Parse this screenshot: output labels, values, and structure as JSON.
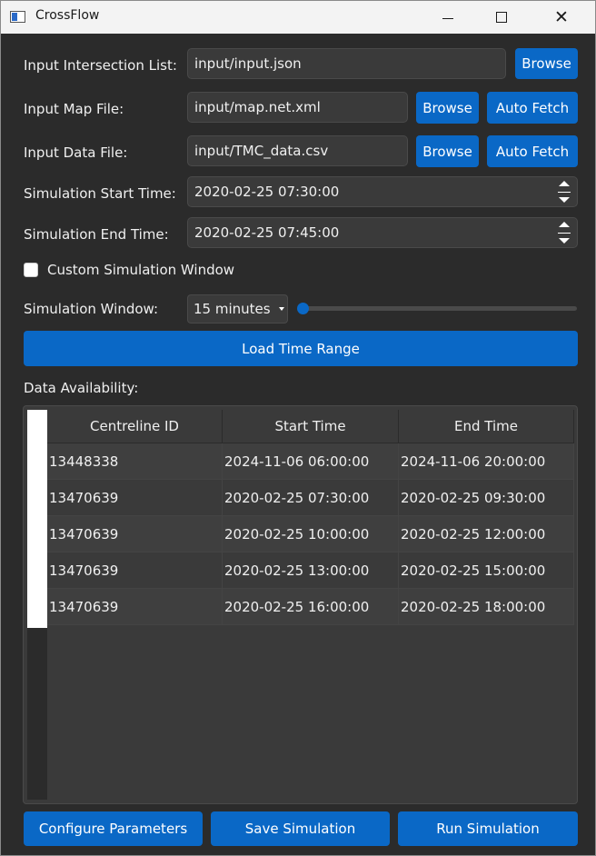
{
  "window": {
    "title": "CrossFlow"
  },
  "form": {
    "intersection_label": "Input Intersection List:",
    "intersection_value": "input/input.json",
    "map_label": "Input Map File:",
    "map_value": "input/map.net.xml",
    "data_label": "Input Data File:",
    "data_value": "input/TMC_data.csv",
    "start_label": "Simulation Start Time:",
    "start_value": "2020-02-25 07:30:00",
    "end_label": "Simulation End Time:",
    "end_value": "2020-02-25 07:45:00",
    "custom_window_label": "Custom Simulation Window",
    "custom_window_checked": false,
    "sim_window_label": "Simulation Window:",
    "sim_window_value": "15 minutes",
    "slider_level": 0.0
  },
  "buttons": {
    "browse": "Browse",
    "auto_fetch": "Auto Fetch",
    "load_time_range": "Load Time Range",
    "configure": "Configure Parameters",
    "save": "Save Simulation",
    "run": "Run Simulation"
  },
  "availability": {
    "label": "Data Availability:",
    "columns": [
      "Centreline ID",
      "Start Time",
      "End Time"
    ],
    "rows": [
      [
        "13448338",
        "2024-11-06 06:00:00",
        "2024-11-06 20:00:00"
      ],
      [
        "13470639",
        "2020-02-25 07:30:00",
        "2020-02-25 09:30:00"
      ],
      [
        "13470639",
        "2020-02-25 10:00:00",
        "2020-02-25 12:00:00"
      ],
      [
        "13470639",
        "2020-02-25 13:00:00",
        "2020-02-25 15:00:00"
      ],
      [
        "13470639",
        "2020-02-25 16:00:00",
        "2020-02-25 18:00:00"
      ]
    ]
  },
  "colors": {
    "accent": "#0a68c6",
    "background": "#2b2b2b",
    "field": "#3a3a3a"
  }
}
